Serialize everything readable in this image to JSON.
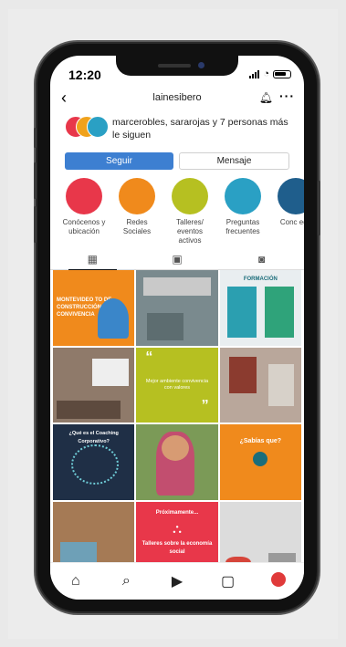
{
  "status": {
    "time": "12:20"
  },
  "profile": {
    "username": "lainesibero",
    "followed_by": "marcerobles, sararojas y 7 personas más le siguen",
    "follow_button": "Seguir",
    "message_button": "Mensaje"
  },
  "highlights": [
    {
      "label": "Conócenos y ubicación",
      "color": "#e8374a"
    },
    {
      "label": "Redes Sociales",
      "color": "#f08a1c"
    },
    {
      "label": "Talleres/ eventos activos",
      "color": "#b6c021"
    },
    {
      "label": "Preguntas frecuentes",
      "color": "#2aa0c4"
    },
    {
      "label": "Conc equ",
      "color": "#1f5e8c"
    }
  ],
  "tabs": [
    "grid-icon",
    "reels-icon",
    "tagged-icon"
  ],
  "posts": {
    "p1": "MONTEVIDEO TO DE CONSTRUCCIÓN DE CONVIVENCIA",
    "p2": "",
    "p3": "FORMACIÓN",
    "p5": "Mejor ambiente\nconvivencia con\nvalores",
    "p7": "¿Qué es el Coaching Corporativo?",
    "p9": "¿Sabías que?",
    "p11": "Próximamente...",
    "p11b": "Talleres sobre la economía social"
  },
  "nav": [
    "home-icon",
    "search-icon",
    "reels-icon",
    "shop-icon",
    "profile-icon"
  ]
}
